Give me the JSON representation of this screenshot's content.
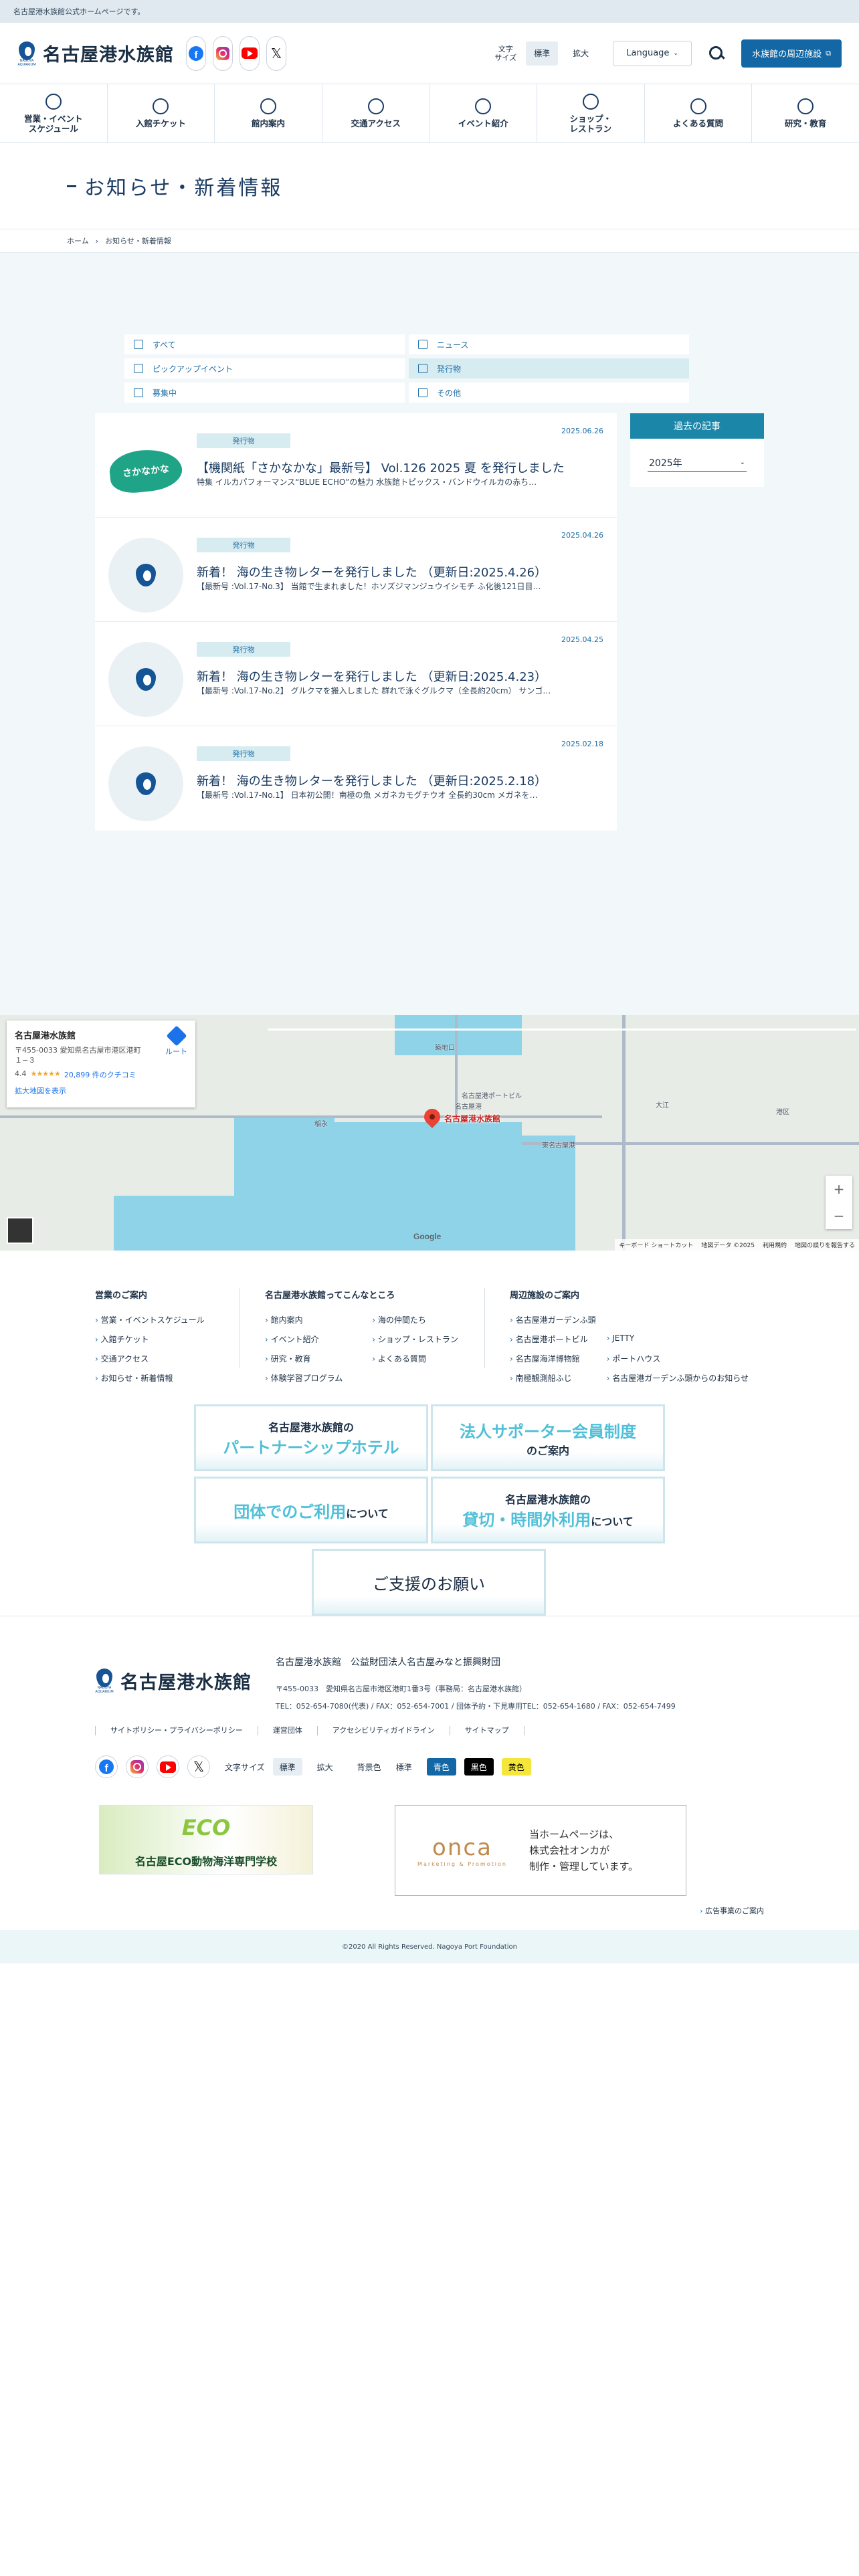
{
  "topbar": {
    "notice": "名古屋港水族館公式ホームページです。"
  },
  "header": {
    "logo_text": "名古屋港水族館",
    "logo_sub": "NAGOYA AQUARIUM",
    "font_size_label": "文字\nサイズ",
    "font_standard": "標準",
    "font_large": "拡大",
    "language": "Language",
    "nearby": "水族館の周辺施設"
  },
  "gnav": [
    {
      "label": "営業・イベント\nスケジュール",
      "icon": "clock-icon"
    },
    {
      "label": "入館チケット",
      "icon": "yen-icon"
    },
    {
      "label": "館内案内",
      "icon": "map-search-icon"
    },
    {
      "label": "交通アクセス",
      "icon": "bus-icon"
    },
    {
      "label": "イベント紹介",
      "icon": "dolphin-icon"
    },
    {
      "label": "ショップ・\nレストラン",
      "icon": "shop-icon"
    },
    {
      "label": "よくある質問",
      "icon": "bulb-icon"
    },
    {
      "label": "研究・教育",
      "icon": "globe-icon"
    }
  ],
  "page": {
    "title": "お知らせ・新着情報",
    "breadcrumb_home": "ホーム",
    "breadcrumb_current": "お知らせ・新着情報"
  },
  "categories": [
    {
      "label": "すべて",
      "active": false
    },
    {
      "label": "ニュース",
      "active": false
    },
    {
      "label": "ピックアップイベント",
      "active": false
    },
    {
      "label": "発行物",
      "active": true
    },
    {
      "label": "募集中",
      "active": false
    },
    {
      "label": "その他",
      "active": false
    }
  ],
  "news": [
    {
      "date": "2025.06.26",
      "tag": "発行物",
      "title": "【機関紙「さかなかな」最新号】 Vol.126 2025 夏 を発行しました",
      "excerpt": "特集 イルカパフォーマンス“BLUE ECHO”の魅力 水族館トピックス・バンドウイルカの赤ち…",
      "thumb_text": "さかなかな"
    },
    {
      "date": "2025.04.26",
      "tag": "発行物",
      "title": "新着！ 海の生き物レターを発行しました （更新日:2025.4.26）",
      "excerpt": "【最新号 :Vol.17-No.3】 当館で生まれました！ホソズジマンジュウイシモチ ふ化後121日目…"
    },
    {
      "date": "2025.04.25",
      "tag": "発行物",
      "title": "新着！ 海の生き物レターを発行しました （更新日:2025.4.23）",
      "excerpt": "【最新号 :Vol.17-No.2】 グルクマを搬入しました 群れで泳ぐグルクマ（全長約20cm） サンゴ…"
    },
    {
      "date": "2025.02.18",
      "tag": "発行物",
      "title": "新着！ 海の生き物レターを発行しました （更新日:2025.2.18）",
      "excerpt": "【最新号 :Vol.17-No.1】 日本初公開！南極の魚 メガネカモグチウオ 全長約30cm メガネを…"
    }
  ],
  "archive": {
    "heading": "過去の記事",
    "selected_year": "2025年"
  },
  "map": {
    "place_name": "名古屋港水族館",
    "address": "〒455-0033 愛知県名古屋市港区港町１−３",
    "route": "ルート",
    "rating": "4.4",
    "stars": "★★★★★",
    "reviews": "20,899 件のクチコミ",
    "bigger_map": "拡大地図を表示",
    "pin_label": "名古屋港水族館",
    "google": "Google",
    "attr_shortcuts": "キーボード ショートカット",
    "attr_data": "地図データ ©2025",
    "attr_terms": "利用規約",
    "attr_report": "地図の誤りを報告する",
    "labels": [
      "名古屋港",
      "築地口",
      "稲永",
      "大江",
      "港区",
      "名古屋港ポートビル",
      "東名古屋港"
    ]
  },
  "footer_links": {
    "col1_title": "営業のご案内",
    "col1": [
      "営業・イベントスケジュール",
      "入館チケット",
      "交通アクセス",
      "お知らせ・新着情報"
    ],
    "col2_title": "名古屋港水族館ってこんなところ",
    "col2a": [
      "館内案内",
      "イベント紹介",
      "研究・教育",
      "体験学習プログラム"
    ],
    "col2b": [
      "海の仲間たち",
      "ショップ・レストラン",
      "よくある質問"
    ],
    "col3_title": "周辺施設のご案内",
    "col3a": [
      "名古屋港ガーデンふ頭",
      "名古屋港ポートビル",
      "名古屋海洋博物館",
      "南極観測船ふじ"
    ],
    "col3b": [
      "JETTY",
      "ポートハウス",
      "名古屋港ガーデンふ頭からのお知らせ"
    ]
  },
  "banners": {
    "partner_line1": "名古屋港水族館の",
    "partner_line2": "パートナーシップホテル",
    "supporter_line1": "法人サポーター会員制度",
    "supporter_line2": "のご案内",
    "group_line1": "団体でのご利用",
    "group_line2": "について",
    "rental_line1": "名古屋港水族館の",
    "rental_line2": "貸切・時間外利用",
    "rental_line3": "について",
    "support_line": "ご支援のお願い"
  },
  "footer_info": {
    "org": "名古屋港水族館　公益財団法人名古屋みなと振興財団",
    "address": "〒455-0033　愛知県名古屋市港区港町1番3号（事務局：名古屋港水族館）",
    "tel": "TEL：052-654-7080(代表) / FAX：052-654-7001 / 団体予約・下見専用TEL：052-654-1680 / FAX：052-654-7499",
    "policy": [
      "サイトポリシー・プライバシーポリシー",
      "運営団体",
      "アクセシビリティガイドライン",
      "サイトマップ"
    ],
    "font_size": "文字サイズ",
    "standard": "標準",
    "large": "拡大",
    "bg_color": "背景色",
    "bg_standard": "標準",
    "bg_blue": "青色",
    "bg_black": "黒色",
    "bg_yellow": "黄色",
    "acoba_eco": "ECO",
    "acoba_name": "名古屋ECO動物海洋専門学校",
    "onca_logo": "onca",
    "onca_sub": "Marketing & Promotion",
    "onca_text_1": "当ホームページは、",
    "onca_text_2": "株式会社オンカが",
    "onca_text_3": "制作・管理しています。",
    "ad": "広告事業のご案内"
  },
  "copyright": "©2020 All Rights Reserved. Nagoya Port Foundation",
  "colors": {
    "accent": "#1367a4",
    "teal": "#1b86a8",
    "tag_bg": "#d7ecf1"
  }
}
